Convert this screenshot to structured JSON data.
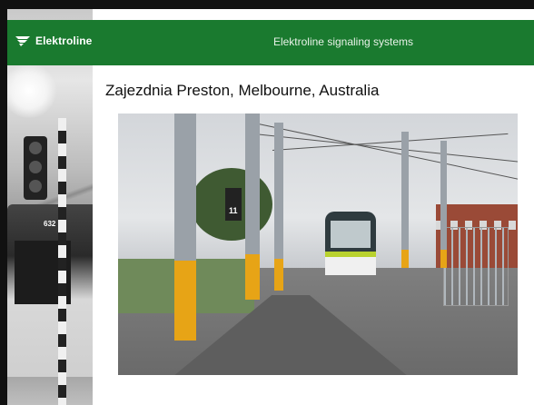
{
  "header": {
    "brand_name": "Elektroline",
    "title": "Elektroline signaling systems"
  },
  "slide": {
    "subtitle": "Zajezdnia Preston, Melbourne, Australia"
  },
  "photo": {
    "signal_number": "11",
    "tram_number": "632"
  },
  "colors": {
    "header_green": "#1a7a2f",
    "pole_yellow": "#e7a416"
  }
}
